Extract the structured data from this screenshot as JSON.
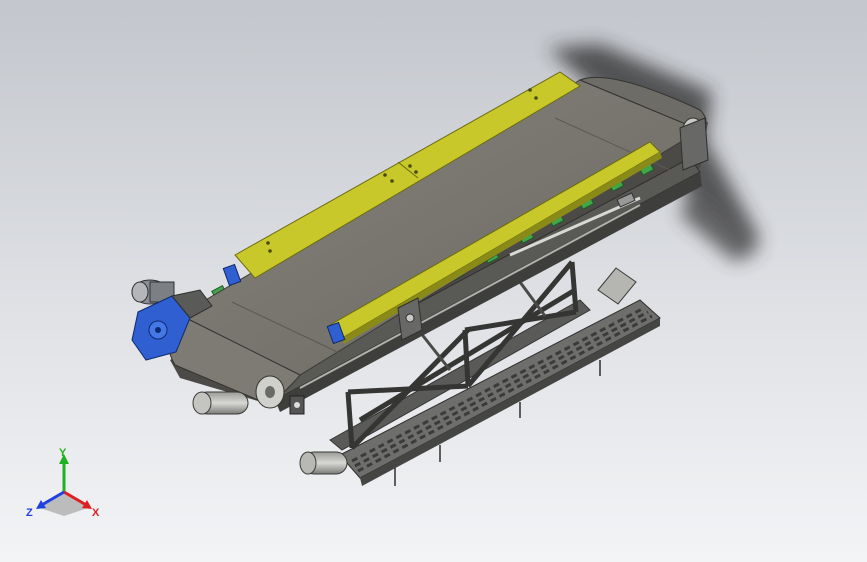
{
  "viewport": {
    "model": "belt-conveyor-assembly",
    "colors": {
      "background_top": "#c3c6cc",
      "background_bottom": "#f3f4f6",
      "belt": "#76746c",
      "belt_dark": "#4e4d48",
      "frame": "#5f5f5d",
      "frame_dark": "#3a3a38",
      "side_guard": "#c8c82a",
      "side_guard_dark": "#8a8a18",
      "idler": "#3fa64a",
      "motor": "#2f5fd0",
      "motor_housing": "#8a8d92",
      "walkway": "#707070"
    }
  },
  "triad": {
    "x_label": "X",
    "y_label": "Y",
    "z_label": "Z",
    "x_color": "#e02020",
    "y_color": "#20b020",
    "z_color": "#2040e0"
  }
}
